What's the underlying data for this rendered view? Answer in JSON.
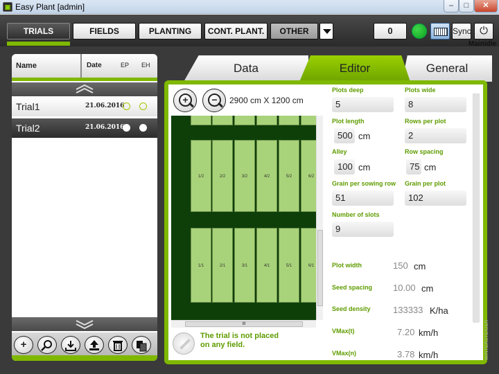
{
  "window": {
    "title": "Easy Plant [admin]",
    "app_icon": "easy-plant-icon",
    "minimize": "–",
    "maximize": "□",
    "close": "✕"
  },
  "topnav": {
    "trials": "TRIALS",
    "fields": "FIELDS",
    "planting": "PLANTING",
    "cont_plant": "CONT. PLANT.",
    "other": "OTHER",
    "counter": "0",
    "sync": "Sync",
    "status": "Mainidle",
    "status_light_color": "#22c035",
    "power_icon": "⏻"
  },
  "trial_list": {
    "columns": {
      "name": "Name",
      "date": "Date",
      "ep": "EP",
      "eh": "EH"
    },
    "rows": [
      {
        "name": "Trial1",
        "date": "21.06.2016"
      },
      {
        "name": "Trial2",
        "date": "21.06.2016"
      }
    ],
    "toolbar_icons": [
      "add-icon",
      "search-icon",
      "download-icon",
      "upload-icon",
      "delete-icon",
      "copy-icon"
    ]
  },
  "tabs": {
    "data": "Data",
    "editor": "Editor",
    "general": "General"
  },
  "editor": {
    "field_dimensions": "2900 cm X 1200 cm",
    "not_placed_line1": "The trial is not placed",
    "not_placed_line2": "on any field.",
    "plots_row2": [
      "1/2",
      "2/2",
      "3/2",
      "4/2",
      "5/2",
      "6/2"
    ],
    "plots_row1": [
      "1/1",
      "2/1",
      "3/1",
      "4/1",
      "5/1",
      "6/1"
    ],
    "hscroll_grip": "III"
  },
  "form": {
    "plots_deep": {
      "label": "Plots deep",
      "value": "5"
    },
    "plots_wide": {
      "label": "Plots wide",
      "value": "8"
    },
    "plot_length": {
      "label": "Plot length",
      "value": "500",
      "unit": "cm"
    },
    "rows_per_plot": {
      "label": "Rows per plot",
      "value": "2"
    },
    "alley": {
      "label": "Alley",
      "value": "100",
      "unit": "cm"
    },
    "row_spacing": {
      "label": "Row spacing",
      "value": "75",
      "unit": "cm"
    },
    "grain_per_sowing_row": {
      "label": "Grain per sowing row",
      "value": "51"
    },
    "grain_per_plot": {
      "label": "Grain per plot",
      "value": "102"
    },
    "number_of_slots": {
      "label": "Number of slots",
      "value": "9"
    },
    "plot_width": {
      "label": "Plot width",
      "value": "150",
      "unit": "cm"
    },
    "seed_spacing": {
      "label": "Seed spacing",
      "value": "10.00",
      "unit": "cm"
    },
    "seed_density": {
      "label": "Seed density",
      "value": "133333",
      "unit": "K/ha"
    },
    "vmax_t": {
      "label": "VMax(t)",
      "value": "7.20",
      "unit": "km/h"
    },
    "vmax_n": {
      "label": "VMax(n)",
      "value": "3.78",
      "unit": "km/h"
    }
  },
  "watermark": "WINTERSTEIGER"
}
